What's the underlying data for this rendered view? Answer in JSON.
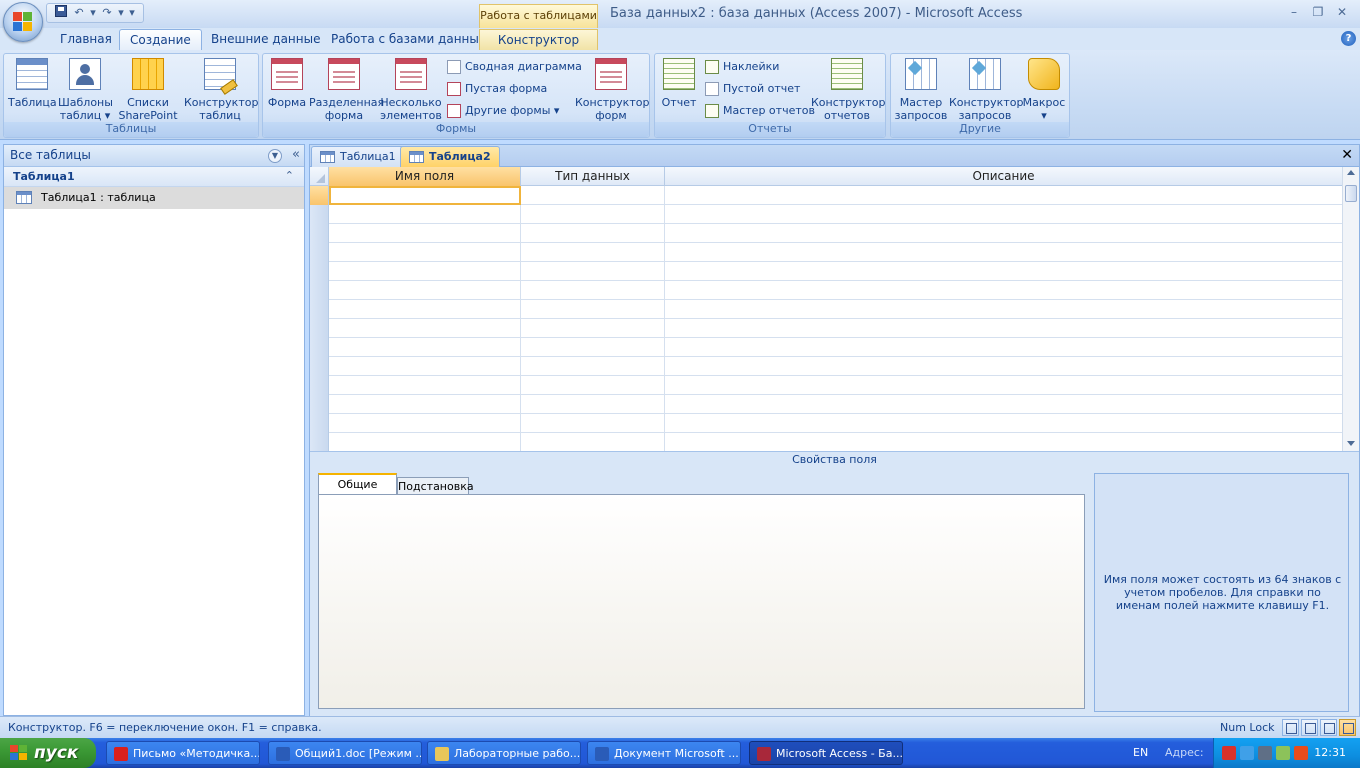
{
  "window": {
    "context_tab_title": "Работа с таблицами",
    "title": "База данных2 : база данных (Access 2007)  -  Microsoft Access"
  },
  "ribbon_tabs": [
    {
      "label": "Главная"
    },
    {
      "label": "Создание"
    },
    {
      "label": "Внешние данные"
    },
    {
      "label": "Работа с базами данных"
    },
    {
      "label": "Конструктор"
    }
  ],
  "ribbon": {
    "tables_group": {
      "label": "Таблицы",
      "table": "Таблица",
      "templates": [
        "Шаблоны",
        "таблиц ▾"
      ],
      "sharepoint": [
        "Списки",
        "SharePoint ▾"
      ],
      "designer": [
        "Конструктор",
        "таблиц"
      ]
    },
    "forms_group": {
      "label": "Формы",
      "form": "Форма",
      "split_form": [
        "Разделенная",
        "форма"
      ],
      "multiple_items": [
        "Несколько",
        "элементов"
      ],
      "pivot_chart": "Сводная диаграмма",
      "blank_form": "Пустая форма",
      "more_forms": "Другие формы ▾",
      "designer": [
        "Конструктор",
        "форм"
      ]
    },
    "reports_group": {
      "label": "Отчеты",
      "report": "Отчет",
      "labels": "Наклейки",
      "blank_report": "Пустой отчет",
      "report_wizard": "Мастер отчетов",
      "designer": [
        "Конструктор",
        "отчетов"
      ]
    },
    "other_group": {
      "label": "Другие",
      "query_wizard": [
        "Мастер",
        "запросов"
      ],
      "query_designer": [
        "Конструктор",
        "запросов"
      ],
      "macro": [
        "Макрос",
        "▾"
      ]
    }
  },
  "nav_pane": {
    "title": "Все таблицы",
    "group": "Таблица1",
    "items": [
      {
        "label": "Таблица1 : таблица"
      }
    ]
  },
  "doc_tabs": [
    {
      "label": "Таблица1"
    },
    {
      "label": "Таблица2"
    }
  ],
  "design_grid": {
    "columns": [
      "Имя поля",
      "Тип данных",
      "Описание"
    ],
    "row_count": 14
  },
  "field_properties": {
    "title": "Свойства поля",
    "tab_general": "Общие",
    "tab_lookup": "Подстановка",
    "help_text": "Имя поля может состоять из 64 знаков с учетом пробелов.  Для справки по именам полей нажмите клавишу F1."
  },
  "status_bar": {
    "text": "Конструктор.  F6 = переключение окон.  F1 = справка.",
    "num_lock": "Num Lock"
  },
  "taskbar": {
    "start": "пуск",
    "buttons": [
      {
        "label": "Письмо «Методичка...",
        "icon_color": "#d9201d"
      },
      {
        "label": "Общий1.doc [Режим ...",
        "icon_color": "#2a5cb8"
      },
      {
        "label": "Лабораторные рабо...",
        "icon_color": "#e8c65a"
      },
      {
        "label": "Документ Microsoft ...",
        "icon_color": "#2a5cb8"
      },
      {
        "label": "Microsoft Access - Ба...",
        "icon_color": "#a8283a"
      }
    ],
    "language": "EN",
    "address_label": "Адрес:",
    "clock": "12:31"
  }
}
